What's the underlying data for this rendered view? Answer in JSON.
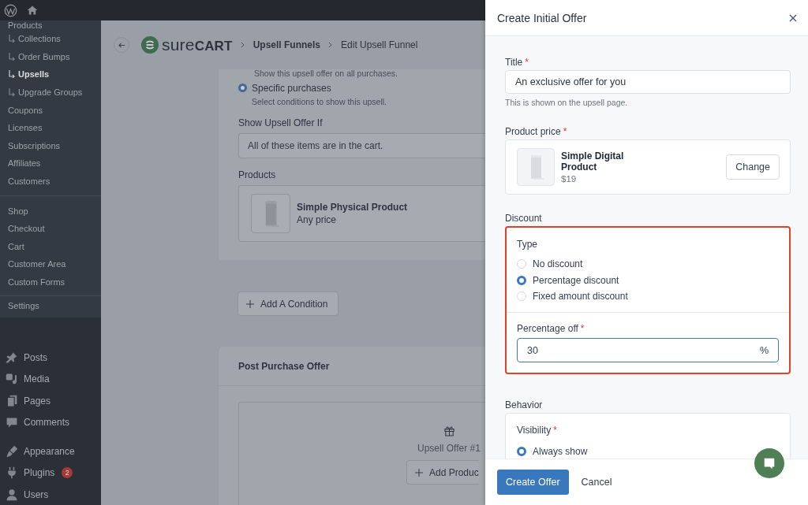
{
  "sidebar": {
    "submenu_groups": [
      {
        "items": [
          {
            "label": "Products",
            "kind": "parent",
            "selected": false
          },
          {
            "label": "Collections",
            "kind": "child",
            "selected": false
          },
          {
            "label": "Order Bumps",
            "kind": "child",
            "selected": false
          },
          {
            "label": "Upsells",
            "kind": "child",
            "selected": true
          },
          {
            "label": "Upgrade Groups",
            "kind": "child",
            "selected": false
          },
          {
            "label": "Coupons",
            "kind": "item",
            "selected": false
          },
          {
            "label": "Licenses",
            "kind": "item",
            "selected": false
          },
          {
            "label": "Subscriptions",
            "kind": "item",
            "selected": false
          },
          {
            "label": "Affiliates",
            "kind": "item",
            "selected": false
          },
          {
            "label": "Customers",
            "kind": "item",
            "selected": false
          }
        ]
      },
      {
        "items": [
          {
            "label": "Shop",
            "kind": "item",
            "selected": false
          },
          {
            "label": "Checkout",
            "kind": "item",
            "selected": false
          },
          {
            "label": "Cart",
            "kind": "item",
            "selected": false
          },
          {
            "label": "Customer Area",
            "kind": "item",
            "selected": false
          },
          {
            "label": "Custom Forms",
            "kind": "item",
            "selected": false
          }
        ]
      },
      {
        "items": [
          {
            "label": "Settings",
            "kind": "item",
            "selected": false
          }
        ]
      }
    ],
    "menu_groups": [
      {
        "items": [
          {
            "label": "Posts"
          },
          {
            "label": "Media"
          },
          {
            "label": "Pages"
          },
          {
            "label": "Comments"
          }
        ]
      },
      {
        "items": [
          {
            "label": "Appearance"
          },
          {
            "label": "Plugins",
            "badge": "2"
          },
          {
            "label": "Users"
          }
        ]
      }
    ]
  },
  "page": {
    "logo": "sure**CART**",
    "breadcrumb": [
      "Upsell Funnels",
      "Edit Upsell Funnel"
    ],
    "conditions": {
      "previous_description": "Show this upsell offer on all purchases.",
      "options": [
        {
          "label": "Specific purchases",
          "description": "Select conditions to show this upsell.",
          "selected": true
        }
      ],
      "show_if": {
        "label": "Show Upsell Offer If",
        "value": "All of these items are in the cart."
      },
      "products": {
        "label": "Products",
        "items": [
          {
            "name": "Simple Physical Product",
            "price": "Any price"
          }
        ]
      }
    },
    "add_condition": "Add A Condition",
    "post_purchase": {
      "title": "Post Purchase Offer",
      "offer_label": "Upsell Offer #1",
      "add_button": "Add Produc"
    }
  },
  "drawer": {
    "title": "Create Initial Offer",
    "title_field": {
      "label": "Title",
      "required_mark": "*",
      "value": "An exclusive offer for you",
      "help": "This is shown on the upsell page."
    },
    "product_price": {
      "label": "Product price",
      "required_mark": "*",
      "product": {
        "name": "Simple Digital Product",
        "price": "$19"
      },
      "button": "Change"
    },
    "discount": {
      "label": "Discount",
      "highlighted": true,
      "type_label": "Type",
      "options": [
        {
          "label": "No discount",
          "selected": false
        },
        {
          "label": "Percentage discount",
          "selected": true
        },
        {
          "label": "Fixed amount discount",
          "selected": false
        }
      ],
      "amount": {
        "label": "Percentage off",
        "required_mark": "*",
        "value": "30",
        "suffix": "%",
        "focused": true
      }
    },
    "behavior": {
      "label": "Behavior",
      "visibility": {
        "label": "Visibility",
        "required_mark": "*",
        "options": [
          {
            "label": "Always show",
            "selected": true
          }
        ]
      }
    },
    "footer": {
      "primary": "Create Offer",
      "secondary": "Cancel"
    }
  }
}
